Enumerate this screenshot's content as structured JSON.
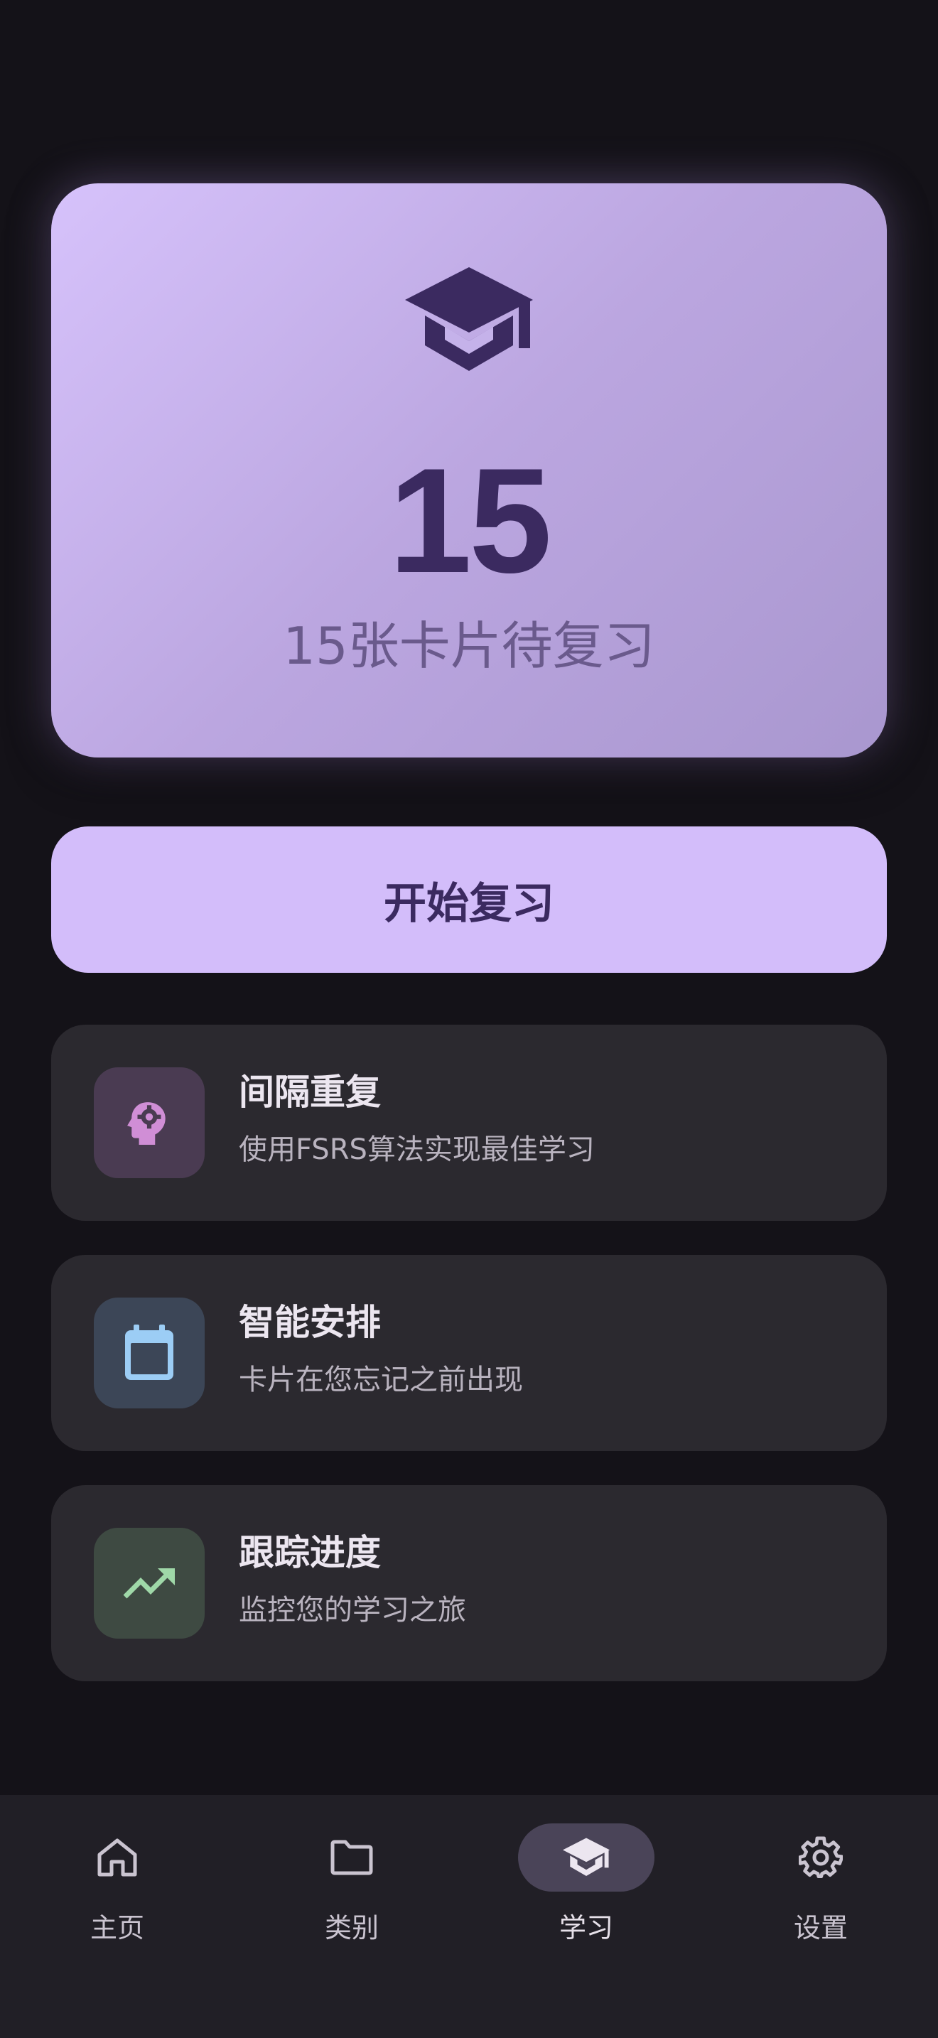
{
  "hero": {
    "icon": "graduation-cap-icon",
    "count": "15",
    "subtitle": "15张卡片待复习"
  },
  "start_button": {
    "label": "开始复习"
  },
  "features": [
    {
      "icon": "psychology-head-gear-icon",
      "title": "间隔重复",
      "description": "使用FSRS算法实现最佳学习",
      "icon_color": "#d08ed6",
      "icon_bg": "#4a3b52"
    },
    {
      "icon": "calendar-icon",
      "title": "智能安排",
      "description": "卡片在您忘记之前出现",
      "icon_color": "#9ccdf5",
      "icon_bg": "#3c4657"
    },
    {
      "icon": "trending-up-icon",
      "title": "跟踪进度",
      "description": "监控您的学习之旅",
      "icon_color": "#9fd8a8",
      "icon_bg": "#3e4a42"
    }
  ],
  "bottom_nav": {
    "items": [
      {
        "label": "主页",
        "icon": "home-icon",
        "active": false
      },
      {
        "label": "类别",
        "icon": "folder-icon",
        "active": false
      },
      {
        "label": "学习",
        "icon": "school-icon",
        "active": true
      },
      {
        "label": "设置",
        "icon": "gear-icon",
        "active": false
      }
    ]
  },
  "colors": {
    "background": "#141218",
    "accent": "#d3bdfa",
    "accent_text": "#3b2a60"
  }
}
